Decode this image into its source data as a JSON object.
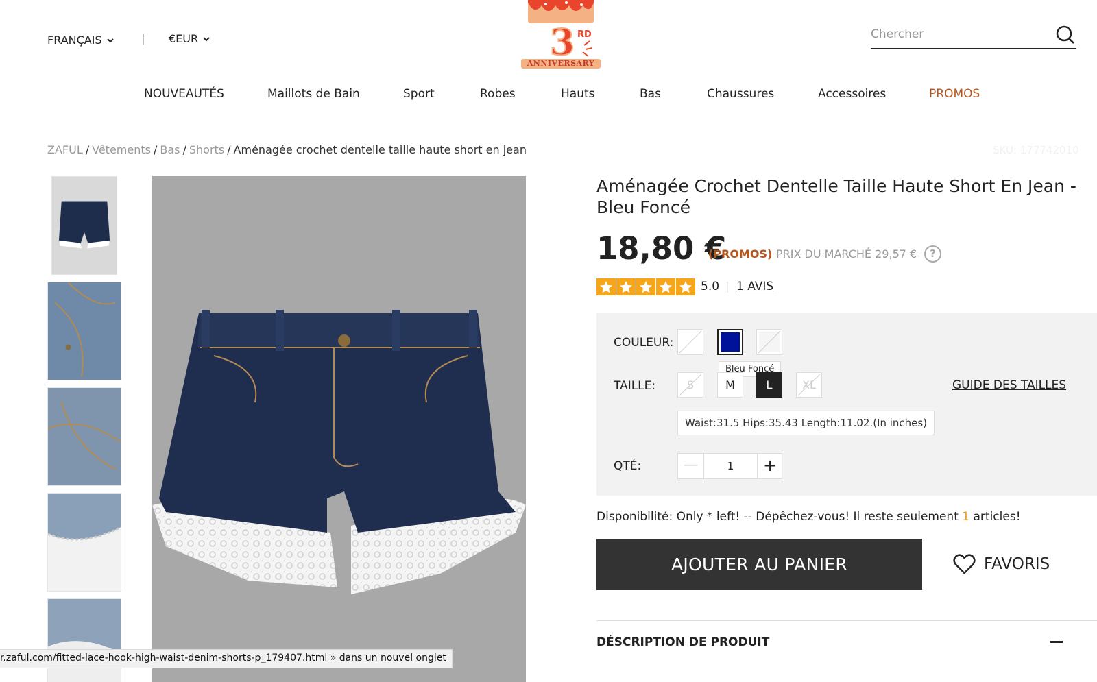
{
  "header": {
    "language": "FRANÇAIS",
    "separator": "|",
    "currency": "€EUR",
    "logo": {
      "number": "3",
      "suffix": "RD",
      "label": "ANNIVERSARY"
    },
    "search": {
      "placeholder": "Chercher",
      "value": ""
    }
  },
  "nav": {
    "items": [
      {
        "label": "NOUVEAUTÉS"
      },
      {
        "label": "Maillots de Bain"
      },
      {
        "label": "Sport"
      },
      {
        "label": "Robes"
      },
      {
        "label": "Hauts"
      },
      {
        "label": "Bas"
      },
      {
        "label": "Chaussures"
      },
      {
        "label": "Accessoires"
      },
      {
        "label": "PROMOS",
        "color": "#b5571e"
      }
    ]
  },
  "breadcrumb": {
    "items": [
      "ZAFUL",
      "Vêtements",
      "Bas",
      "Shorts"
    ],
    "current": "Aménagée crochet dentelle taille haute short en jean"
  },
  "sku": "SKU: 177742010",
  "gallery": {
    "thumbnail_count": 5,
    "main_image": "denim-lace-shorts"
  },
  "status_bar": {
    "url": "r.zaful.com/fitted-lace-hook-high-waist-denim-shorts-p_179407.html",
    "suffix": "» dans un nouvel onglet"
  },
  "product": {
    "title": "Aménagée Crochet Dentelle Taille Haute Short En Jean - Bleu Foncé",
    "price": "18,80 €",
    "promo_tag": "(PROMOS)",
    "market_price": "PRIX DU MARCHÉ 29,57 €",
    "help": "?",
    "rating": "5.0",
    "rating_separator": "|",
    "stars": 5,
    "reviews": "1 AVIS",
    "colors": {
      "label": "COULEUR:",
      "selected_tooltip": "Bleu Foncé",
      "swatches": [
        {
          "name": "unavailable",
          "available": false
        },
        {
          "name": "Bleu Foncé",
          "color": "#00129a",
          "selected": true
        },
        {
          "name": "unavailable",
          "available": false
        }
      ]
    },
    "sizes": {
      "label": "TAILLE:",
      "options": [
        {
          "label": "S",
          "available": false
        },
        {
          "label": "M",
          "available": true
        },
        {
          "label": "L",
          "available": true,
          "selected": true
        },
        {
          "label": "XL",
          "available": false
        }
      ],
      "guide": "GUIDE DES TAILLES",
      "measurements": "Waist:31.5   Hips:35.43   Length:11.02.(In inches)"
    },
    "quantity": {
      "label": "QTÉ:",
      "value": "1",
      "minus": "—",
      "plus": "+"
    },
    "availability": {
      "prefix": "Disponibilité: Only * left! -- Dépêchez-vous! Il reste seulement ",
      "count": "1",
      "suffix": " articles!"
    },
    "add_to_cart": "AJOUTER AU PANIER",
    "favorites": "FAVORIS",
    "description_title": "DÉSCRIPTION DE PRODUIT",
    "description_toggle": "collapse"
  },
  "colors": {
    "accent": "#b5571e",
    "button_dark": "#333333",
    "star": "#f7a51b",
    "panel": "#f2f2f2",
    "availability": "#e6a11c"
  }
}
